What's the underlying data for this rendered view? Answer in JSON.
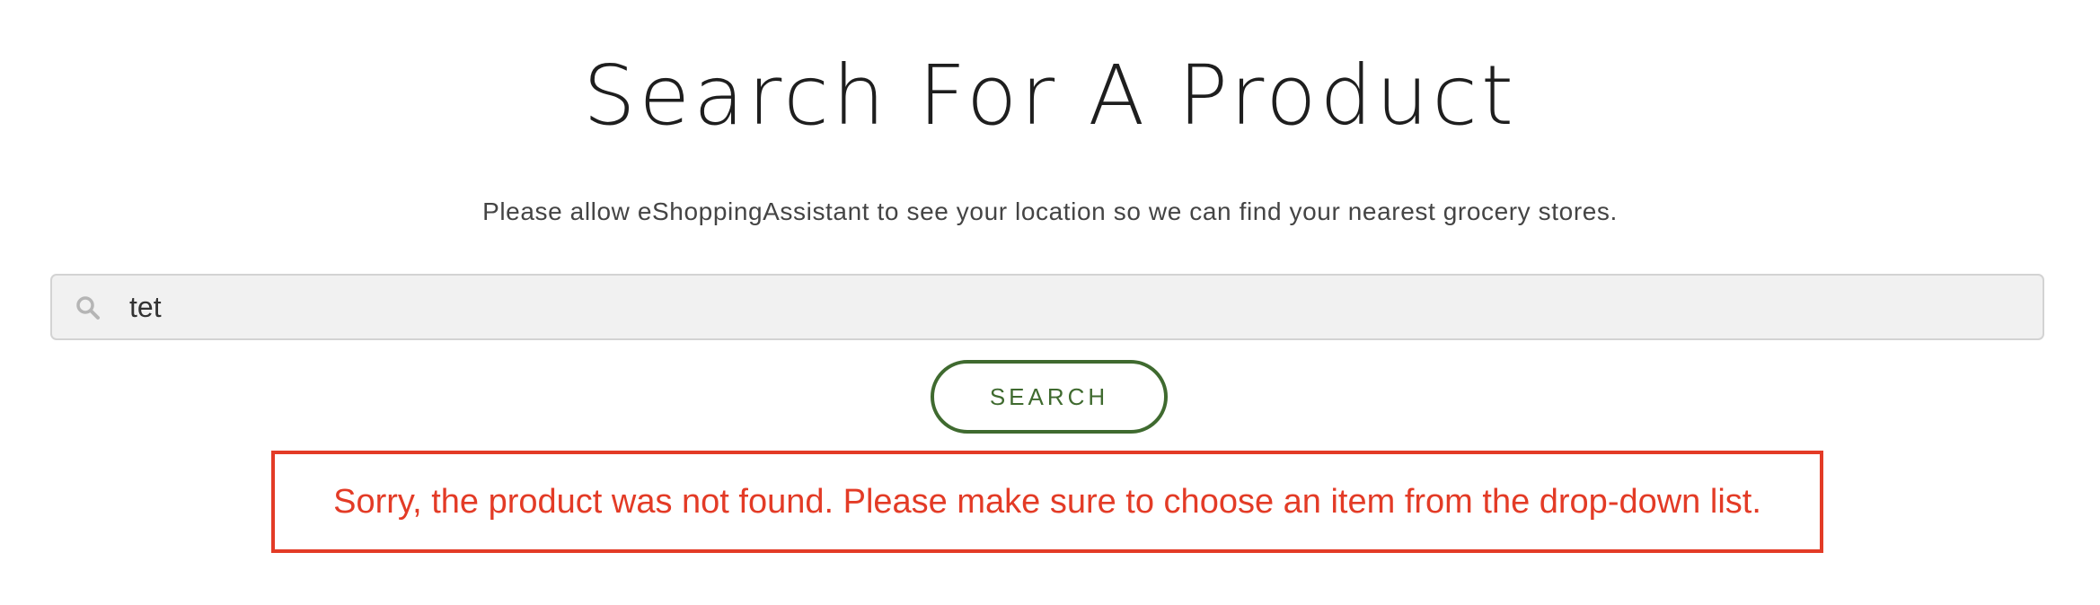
{
  "header": {
    "title": "Search For A Product",
    "subtitle": "Please allow eShoppingAssistant to see your location so we can find your nearest grocery stores."
  },
  "search": {
    "icon": "search-icon",
    "value": "tet",
    "button_label": "SEARCH"
  },
  "error": {
    "message": "Sorry, the product was not found. Please make sure to choose an item from the drop-down list."
  },
  "colors": {
    "accent_green": "#3f6a2f",
    "error_red": "#e33b26",
    "input_background": "#f1f1f1"
  }
}
